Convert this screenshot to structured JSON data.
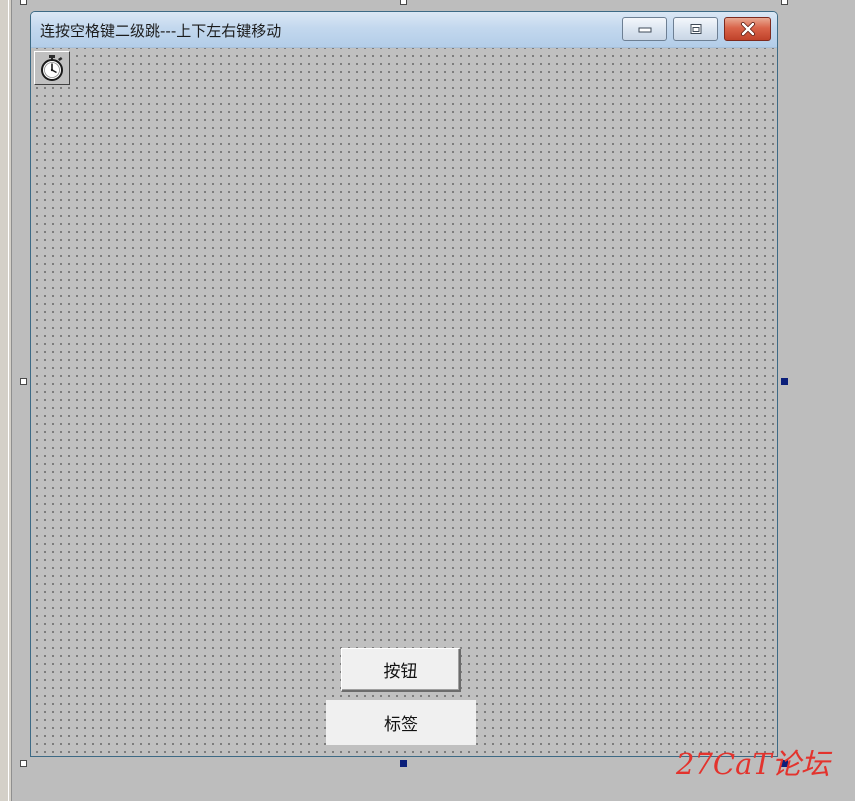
{
  "window": {
    "title": "连按空格键二级跳---上下左右键移动"
  },
  "title_buttons": {
    "minimize_icon": "minimize-icon",
    "maximize_icon": "maximize-icon",
    "close_icon": "close-icon"
  },
  "components": {
    "timer_icon": "stopwatch-icon"
  },
  "controls": {
    "button_label": "按钮",
    "label_text": "标签"
  },
  "watermark": {
    "text": "27CaT论坛"
  },
  "colors": {
    "client_background": "#c0c0c0",
    "close_button": "#c8462c",
    "selection_handle_active": "#0b1f7a",
    "watermark": "#e3332d"
  }
}
